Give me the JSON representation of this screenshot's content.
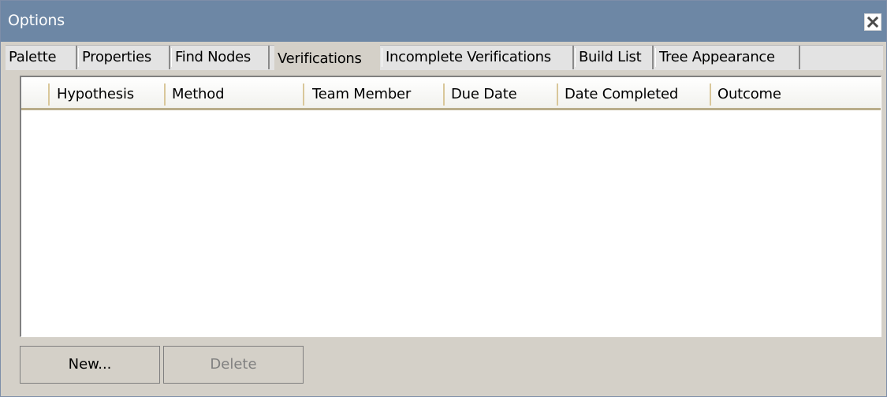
{
  "window": {
    "title": "Options",
    "close_icon": "close-x-icon"
  },
  "tabs": [
    {
      "label": "Palette",
      "active": false
    },
    {
      "label": "Properties",
      "active": false
    },
    {
      "label": "Find Nodes",
      "active": false
    },
    {
      "label": "Verifications",
      "active": true
    },
    {
      "label": "Incomplete Verifications",
      "active": false
    },
    {
      "label": "Build List",
      "active": false
    },
    {
      "label": "Tree Appearance",
      "active": false
    }
  ],
  "table": {
    "columns": [
      "Hypothesis",
      "Method",
      "Team Member",
      "Due Date",
      "Date Completed",
      "Outcome"
    ],
    "rows": []
  },
  "buttons": {
    "new_label": "New...",
    "delete_label": "Delete",
    "delete_enabled": false
  },
  "colors": {
    "titlebar": "#6d87a5",
    "panel": "#d4d0c8",
    "header_underline": "#b9ad8a"
  }
}
